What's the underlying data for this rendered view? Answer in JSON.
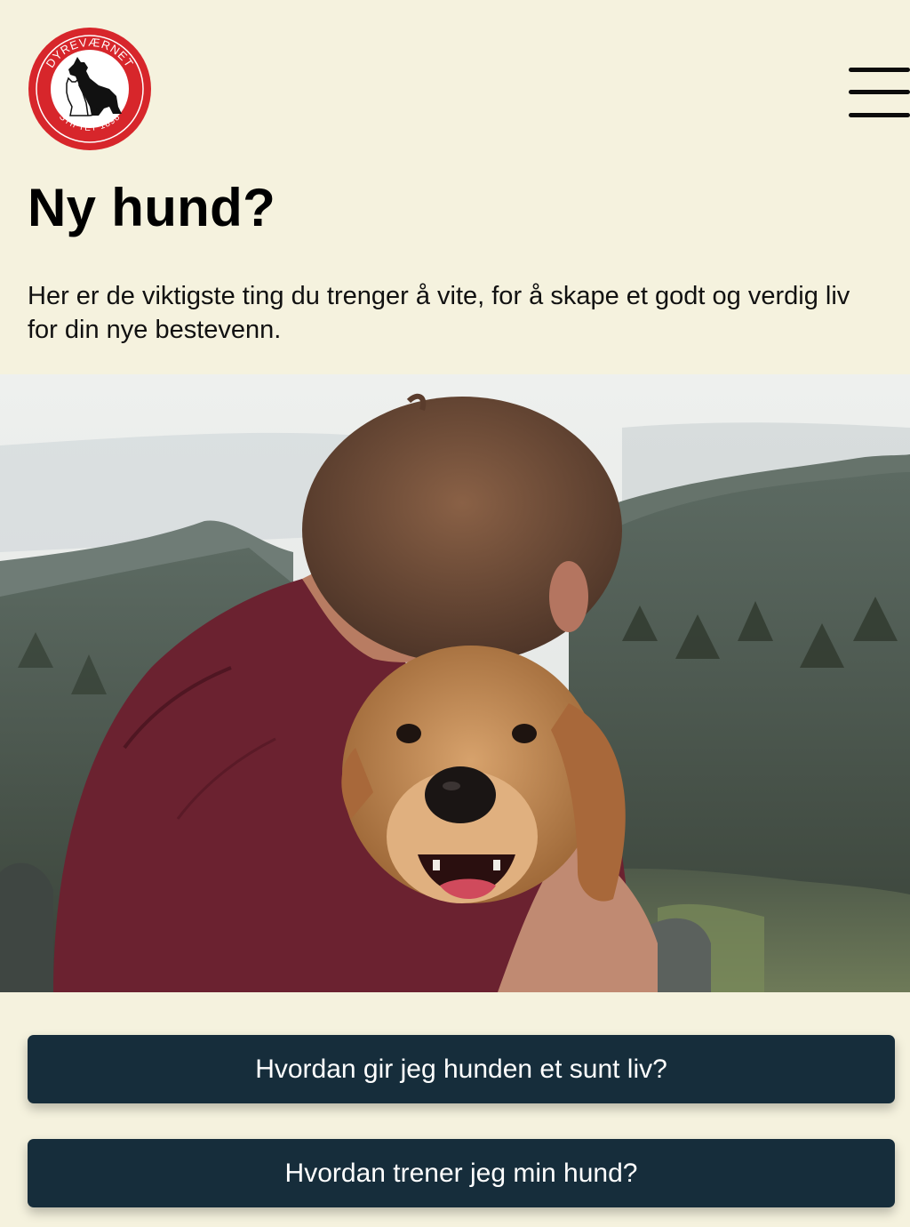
{
  "header": {
    "logo": {
      "icon": "dyrevaernet-logo",
      "top_text": "DYREVÆRNET",
      "bottom_text": "STIFTET 1898",
      "ring_color": "#d7262b"
    },
    "menu_icon": "hamburger-menu-icon"
  },
  "main": {
    "title": "Ny hund?",
    "intro": "Her er de viktigste ting du trenger å vite, for å skape et godt og verdig liv for din nye bestevenn.",
    "hero_image": "man-hugging-golden-retriever-photo"
  },
  "actions": [
    {
      "label": "Hvordan gir jeg hunden et sunt liv?"
    },
    {
      "label": "Hvordan trener jeg min hund?"
    }
  ],
  "colors": {
    "background": "#f5f2de",
    "button": "#162d3b",
    "button_text": "#ffffff"
  }
}
